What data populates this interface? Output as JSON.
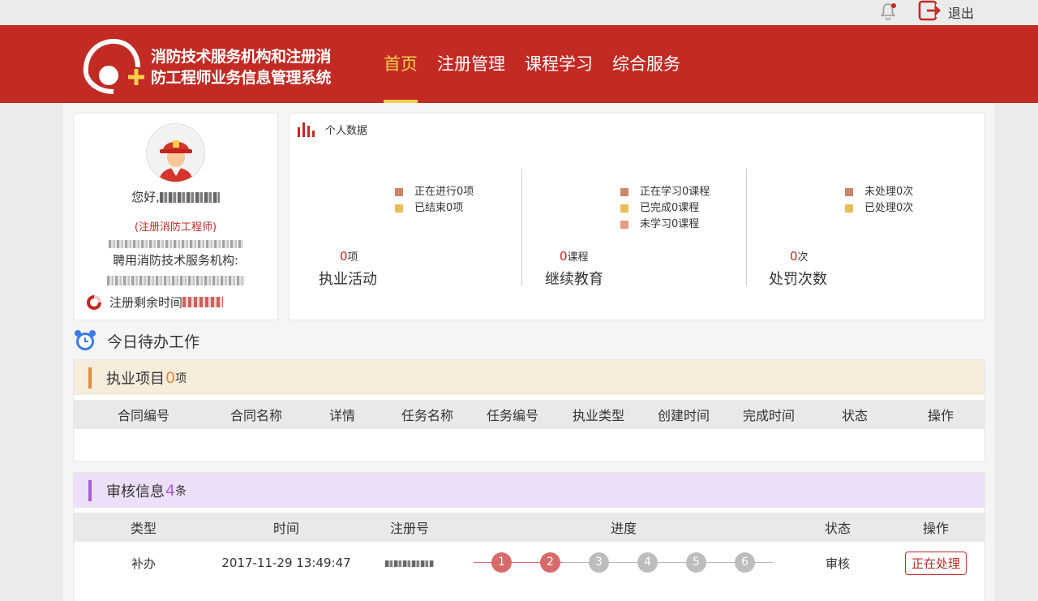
{
  "topbar": {
    "logout_label": "退出"
  },
  "header": {
    "system_title_line1": "消防技术服务机构和注册消",
    "system_title_line2": "防工程师业务信息管理系统",
    "nav": [
      "首页",
      "注册管理",
      "课程学习",
      "综合服务"
    ],
    "active_nav": 0
  },
  "profile": {
    "greeting_prefix": "您好,",
    "role": "(注册消防工程师)",
    "org_label": "聘用消防技术服务机构:",
    "remain_label": "注册剩余时间"
  },
  "personal_data": {
    "title": "个人数据",
    "practice": {
      "legend": [
        {
          "label": "正在进行0项",
          "color": "#c9866a"
        },
        {
          "label": "已结束0项",
          "color": "#e8bd55"
        }
      ],
      "value": "0",
      "unit": "项",
      "title": "执业活动"
    },
    "education": {
      "legend": [
        {
          "label": "正在学习0课程",
          "color": "#c9866a"
        },
        {
          "label": "已完成0课程",
          "color": "#e8bd55"
        },
        {
          "label": "未学习0课程",
          "color": "#e89a86"
        }
      ],
      "value": "0",
      "unit": "课程",
      "title": "继续教育"
    },
    "penalty": {
      "legend": [
        {
          "label": "未处理0次",
          "color": "#c9866a"
        },
        {
          "label": "已处理0次",
          "color": "#e8bd55"
        }
      ],
      "value": "0",
      "unit": "次",
      "title": "处罚次数"
    }
  },
  "todo": {
    "title": "今日待办工作",
    "projects": {
      "title": "执业项目",
      "count": "0",
      "unit": "项",
      "accent": "#e58a3a",
      "bg": "#f5ecdc",
      "columns": [
        "合同编号",
        "合同名称",
        "详情",
        "任务名称",
        "任务编号",
        "执业类型",
        "创建时间",
        "完成时间",
        "状态",
        "操作"
      ]
    },
    "review": {
      "title": "审核信息",
      "count": "4",
      "unit": "条",
      "accent": "#a45fd6",
      "bg": "#eddff8",
      "columns": [
        "类型",
        "时间",
        "注册号",
        "进度",
        "状态",
        "操作"
      ],
      "rows": [
        {
          "type": "补办",
          "time": "2017-11-29 13:49:47",
          "steps": [
            "1",
            "2",
            "3",
            "4",
            "5",
            "6"
          ],
          "done": 2,
          "status": "审核",
          "action": "正在处理"
        }
      ]
    }
  }
}
